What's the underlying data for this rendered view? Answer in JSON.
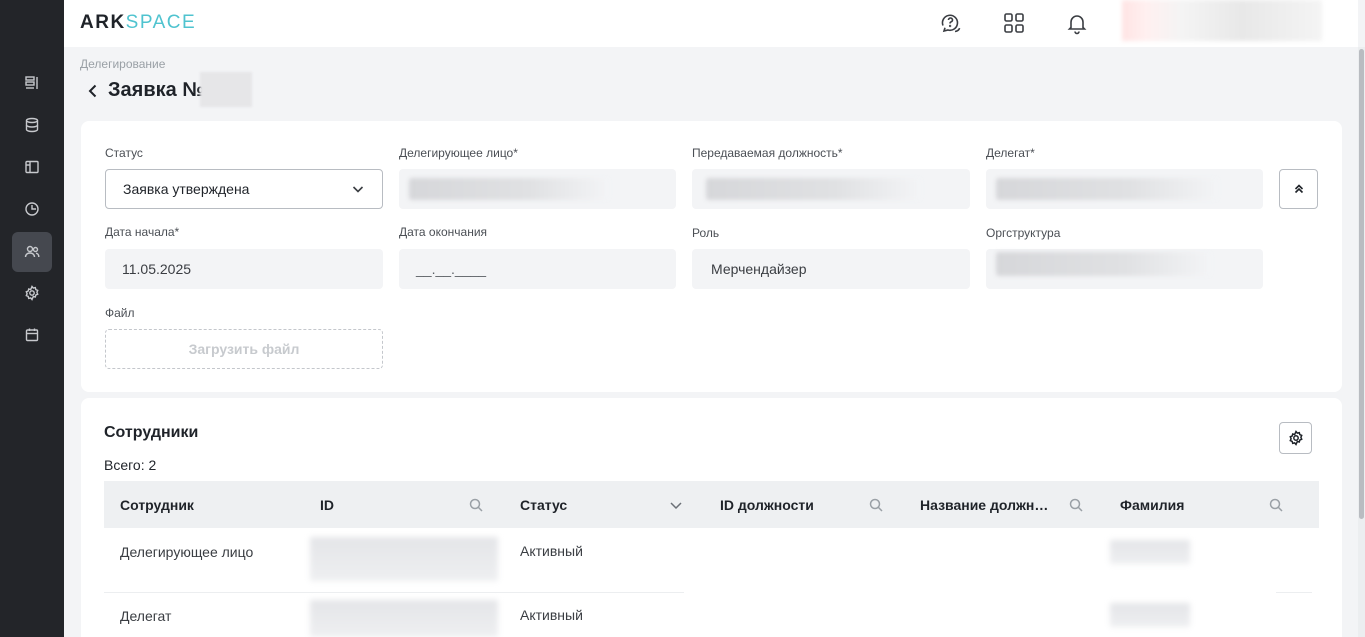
{
  "app": {
    "logo_part1": "ARK",
    "logo_part2": "SPACE",
    "icons": [
      "support-chat-icon",
      "apps-grid-icon",
      "bell-icon"
    ]
  },
  "sidebar": {
    "items": [
      {
        "name": "sidebar-item-list",
        "icon": "list-icon",
        "active": false
      },
      {
        "name": "sidebar-item-database",
        "icon": "database-icon",
        "active": false
      },
      {
        "name": "sidebar-item-layout",
        "icon": "layout-icon",
        "active": false
      },
      {
        "name": "sidebar-item-reports",
        "icon": "pie-chart-icon",
        "active": false
      },
      {
        "name": "sidebar-item-users",
        "icon": "users-icon",
        "active": true
      },
      {
        "name": "sidebar-item-settings",
        "icon": "gear-icon",
        "active": false
      },
      {
        "name": "sidebar-item-calendar",
        "icon": "calendar-icon",
        "active": false
      }
    ]
  },
  "breadcrumb": "Делегирование",
  "page": {
    "title": "Заявка №"
  },
  "form": {
    "status_label": "Статус",
    "status_value": "Заявка утверждена",
    "delegator_label": "Делегирующее лицо*",
    "position_label": "Передаваемая должность*",
    "delegate_label": "Делегат*",
    "start_label": "Дата начала*",
    "start_value": "11.05.2025",
    "end_label": "Дата окончания",
    "end_placeholder": "__.__.____",
    "role_label": "Роль",
    "role_value": "Мерчендайзер",
    "org_label": "Оргструктура",
    "file_label": "Файл",
    "upload_label": "Загрузить файл"
  },
  "employees": {
    "title": "Сотрудники",
    "total": "Всего: 2",
    "columns": [
      "Сотрудник",
      "ID",
      "Статус",
      "ID должности",
      "Название должн…",
      "Фамилия"
    ],
    "rows": [
      {
        "employee": "Делегирующее лицо",
        "status": "Активный"
      },
      {
        "employee": "Делегат",
        "status": "Активный"
      }
    ]
  },
  "colors": {
    "accent": "#4fc3cf",
    "sidebar_bg": "#232529"
  }
}
